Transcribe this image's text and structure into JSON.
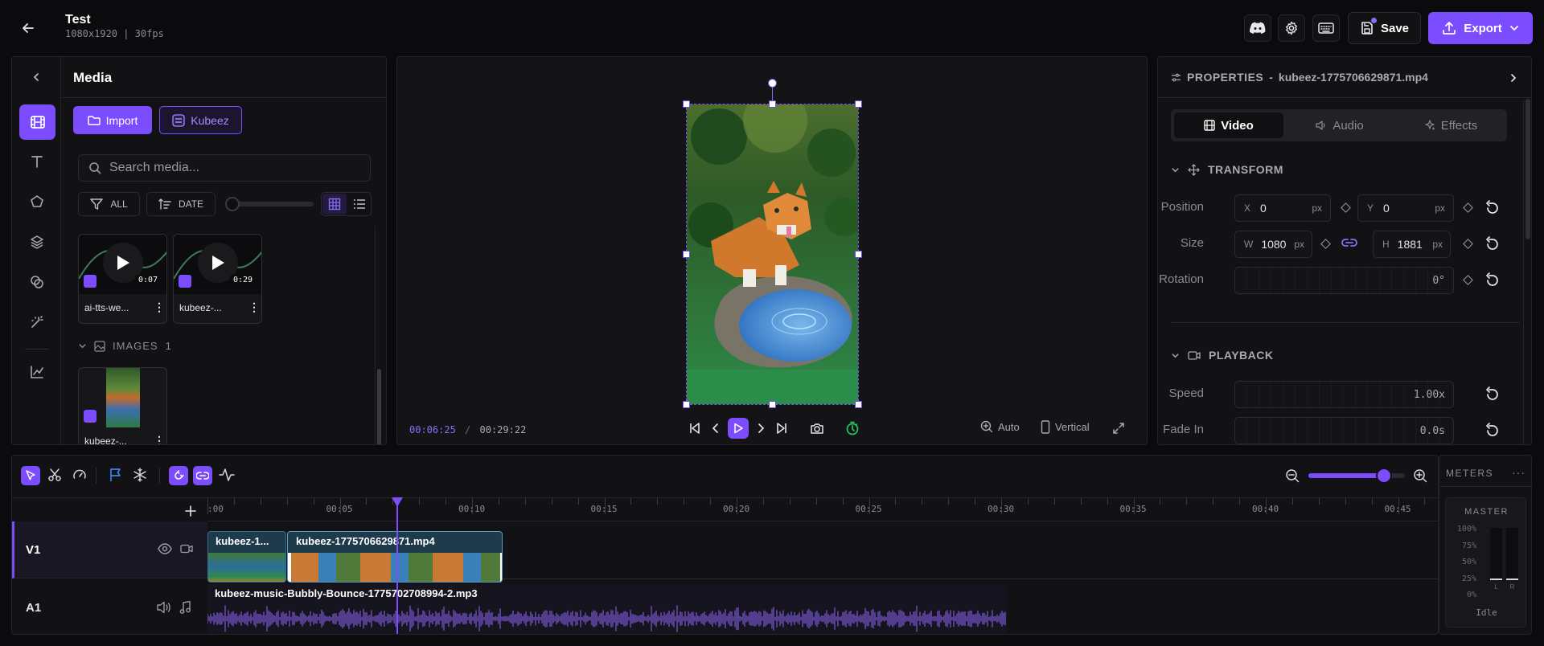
{
  "project": {
    "title": "Test",
    "meta": "1080x1920 | 30fps"
  },
  "header": {
    "save_label": "Save",
    "export_label": "Export"
  },
  "media_panel": {
    "title": "Media",
    "import_label": "Import",
    "kubeez_label": "Kubeez",
    "search_placeholder": "Search media...",
    "filter_all": "ALL",
    "sort_date": "DATE",
    "items": [
      {
        "name": "ai-tts-we...",
        "duration": "0:07"
      },
      {
        "name": "kubeez-...",
        "duration": "0:29"
      }
    ],
    "images_section": {
      "label": "IMAGES",
      "count": "1"
    },
    "image_items": [
      {
        "name": "kubeez-..."
      }
    ]
  },
  "preview": {
    "current_time": "00:06:25",
    "separator": "/",
    "total_time": "00:29:22",
    "zoom_label": "Auto",
    "orientation_label": "Vertical"
  },
  "properties": {
    "header_label": "PROPERTIES",
    "header_sep": "-",
    "file_name": "kubeez-1775706629871.mp4",
    "tabs": [
      {
        "label": "Video"
      },
      {
        "label": "Audio"
      },
      {
        "label": "Effects"
      }
    ],
    "transform_label": "TRANSFORM",
    "position_label": "Position",
    "x_label": "X",
    "x_value": "0",
    "x_unit": "px",
    "y_label": "Y",
    "y_value": "0",
    "y_unit": "px",
    "size_label": "Size",
    "w_label": "W",
    "w_value": "1080",
    "w_unit": "px",
    "h_label": "H",
    "h_value": "1881",
    "h_unit": "px",
    "rotation_label": "Rotation",
    "rotation_value": "0°",
    "playback_label": "PLAYBACK",
    "speed_label": "Speed",
    "speed_value": "1.00x",
    "fadein_label": "Fade In",
    "fadein_value": "0.0s"
  },
  "timeline": {
    "ruler_labels": [
      ":00",
      "00:05",
      "00:10",
      "00:15",
      "00:20",
      "00:25",
      "00:30",
      "00:35",
      "00:40",
      "00:45"
    ],
    "tracks": [
      {
        "label": "V1"
      },
      {
        "label": "A1"
      }
    ],
    "clips": {
      "video_clip_1": "kubeez-1...",
      "video_clip_2": "kubeez-1775706629871.mp4",
      "audio_clip": "kubeez-music-Bubbly-Bounce-1775702708994-2.mp3"
    },
    "zoom_level": 0.78
  },
  "meters": {
    "title": "METERS",
    "master_label": "MASTER",
    "scale": [
      "100%",
      "75%",
      "50%",
      "25%",
      "0%"
    ],
    "channels": [
      "L",
      "R"
    ],
    "status": "Idle"
  },
  "colors": {
    "accent": "#7c4dff",
    "accent_light": "#8b6cf6",
    "timer_green": "#22c55e",
    "flag_blue": "#3b82f6"
  }
}
